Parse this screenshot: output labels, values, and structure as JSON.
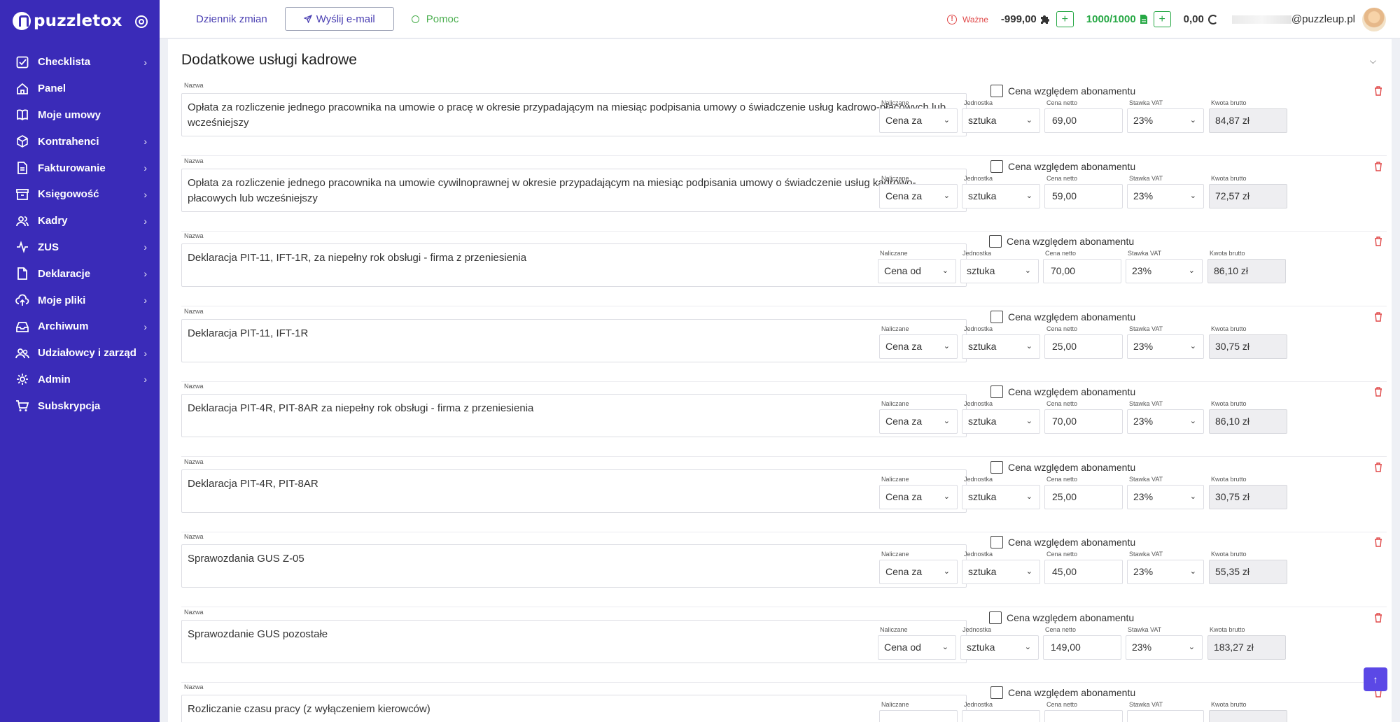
{
  "app": {
    "brand": "puzzletox"
  },
  "sidebar": {
    "items": [
      {
        "label": "Checklista",
        "icon": "checklist-icon",
        "chevron": true
      },
      {
        "label": "Panel",
        "icon": "home-icon",
        "chevron": false
      },
      {
        "label": "Moje umowy",
        "icon": "book-icon",
        "chevron": false
      },
      {
        "label": "Kontrahenci",
        "icon": "box-icon",
        "chevron": true
      },
      {
        "label": "Fakturowanie",
        "icon": "document-icon",
        "chevron": true
      },
      {
        "label": "Księgowość",
        "icon": "archive-box-icon",
        "chevron": true
      },
      {
        "label": "Kadry",
        "icon": "users-icon",
        "chevron": true
      },
      {
        "label": "ZUS",
        "icon": "activity-icon",
        "chevron": true
      },
      {
        "label": "Deklaracje",
        "icon": "file-icon",
        "chevron": true
      },
      {
        "label": "Moje pliki",
        "icon": "cloud-upload-icon",
        "chevron": true
      },
      {
        "label": "Archiwum",
        "icon": "inbox-icon",
        "chevron": true
      },
      {
        "label": "Udziałowcy i zarząd",
        "icon": "user-group-icon",
        "chevron": true
      },
      {
        "label": "Admin",
        "icon": "gear-icon",
        "chevron": true
      },
      {
        "label": "Subskrypcja",
        "icon": "cart-icon",
        "chevron": false
      }
    ]
  },
  "topbar": {
    "changelog": "Dziennik zmian",
    "send_email": "Wyślij e-mail",
    "help": "Pomoc",
    "important": "Ważne",
    "puzzle_balance": "-999,00",
    "docs_balance": "1000/1000",
    "plus": "+",
    "zero_balance": "0,00",
    "email_suffix": "@puzzleup.pl"
  },
  "section": {
    "title": "Dodatkowe usługi kadrowe"
  },
  "labels": {
    "name": "Nazwa",
    "subscription_price": "Cena względem abonamentu",
    "charged": "Naliczane",
    "unit": "Jednostka",
    "net_price": "Cena netto",
    "vat_rate": "Stawka VAT",
    "gross_amount": "Kwota brutto"
  },
  "services": [
    {
      "name": "Opłata za rozliczenie jednego pracownika na umowie o pracę w okresie przypadającym na miesiąc podpisania umowy o świadczenie usług kadrowo-płacowych lub wcześniejszy",
      "charged": "Cena za",
      "unit": "sztuka",
      "net": "69,00",
      "vat": "23%",
      "gross": "84,87 zł"
    },
    {
      "name": "Opłata za rozliczenie jednego pracownika na umowie cywilnoprawnej w okresie przypadającym na miesiąc podpisania umowy o świadczenie usług kadrowo-płacowych lub wcześniejszy",
      "charged": "Cena za",
      "unit": "sztuka",
      "net": "59,00",
      "vat": "23%",
      "gross": "72,57 zł"
    },
    {
      "name": "Deklaracja PIT-11, IFT-1R, za niepełny rok obsługi - firma z przeniesienia",
      "charged": "Cena od",
      "unit": "sztuka",
      "net": "70,00",
      "vat": "23%",
      "gross": "86,10 zł"
    },
    {
      "name": "Deklaracja PIT-11, IFT-1R",
      "charged": "Cena za",
      "unit": "sztuka",
      "net": "25,00",
      "vat": "23%",
      "gross": "30,75 zł"
    },
    {
      "name": "Deklaracja PIT-4R, PIT-8AR za niepełny rok obsługi - firma z przeniesienia",
      "charged": "Cena za",
      "unit": "sztuka",
      "net": "70,00",
      "vat": "23%",
      "gross": "86,10 zł"
    },
    {
      "name": "Deklaracja PIT-4R, PIT-8AR",
      "charged": "Cena za",
      "unit": "sztuka",
      "net": "25,00",
      "vat": "23%",
      "gross": "30,75 zł"
    },
    {
      "name": "Sprawozdania GUS Z-05",
      "charged": "Cena za",
      "unit": "sztuka",
      "net": "45,00",
      "vat": "23%",
      "gross": "55,35 zł"
    },
    {
      "name": "Sprawozdanie GUS pozostałe",
      "charged": "Cena od",
      "unit": "sztuka",
      "net": "149,00",
      "vat": "23%",
      "gross": "183,27 zł"
    },
    {
      "name": "Rozliczanie czasu pracy (z wyłączeniem kierowców)",
      "charged": "",
      "unit": "",
      "net": "",
      "vat": "",
      "gross": ""
    }
  ]
}
